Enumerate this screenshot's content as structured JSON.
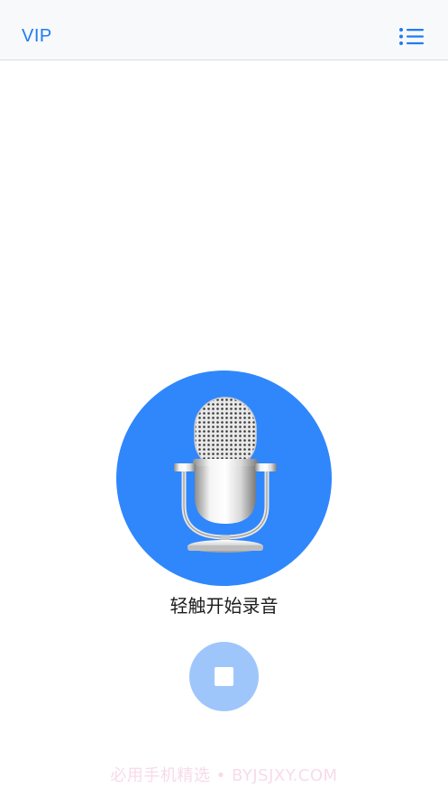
{
  "header": {
    "vip_label": "VIP",
    "menu_icon": "list-menu-icon"
  },
  "recorder": {
    "mic_icon": "microphone-icon",
    "hint_text": "轻触开始录音",
    "stop_icon": "stop-icon"
  },
  "watermark": {
    "text": "必用手机精选 • BYJSJXY.COM"
  },
  "colors": {
    "accent": "#1f7cf0",
    "mic_circle": "#2f87fb",
    "stop_button": "#9fc6fb"
  }
}
